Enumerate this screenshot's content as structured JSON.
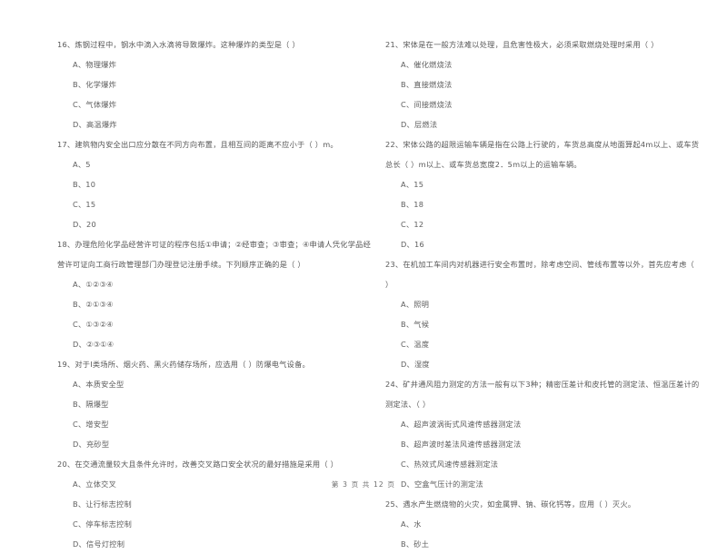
{
  "document": {
    "type": "exam-paper",
    "footer": "第 3 页  共 12 页"
  },
  "columns": [
    {
      "side": "left",
      "questions": [
        {
          "number": "16",
          "lines": [
            "16、炼钢过程中，钢水中滴入水滴将导致爆炸。这种爆炸的类型是（      ）"
          ],
          "options": [
            "A、物理爆炸",
            "B、化学爆炸",
            "C、气体爆炸",
            "D、高温爆炸"
          ]
        },
        {
          "number": "17",
          "lines": [
            "17、建筑物内安全出口应分散在不同方向布置，且相互间的距离不应小于（      ）m。"
          ],
          "options": [
            "A、5",
            "B、10",
            "C、15",
            "D、20"
          ]
        },
        {
          "number": "18",
          "lines": [
            "18、办理危险化学品经营许可证的程序包括①申请；②经审查；③审查；④申请人凭化学品经",
            "营许可证向工商行政管理部门办理登记注册手续。下列顺序正确的是（      ）"
          ],
          "options": [
            "A、①②③④",
            "B、②①③④",
            "C、①③②④",
            "D、②③①④"
          ]
        },
        {
          "number": "19",
          "lines": [
            "19、对于Ⅰ类场所、烟火药、黑火药储存场所，应选用（      ）防爆电气设备。"
          ],
          "options": [
            "A、本质安全型",
            "B、隔爆型",
            "C、增安型",
            "D、充砂型"
          ]
        },
        {
          "number": "20",
          "lines": [
            "20、在交通流量较大且条件允许时，改善交叉路口安全状况的最好措施是采用（      ）"
          ],
          "options": [
            "A、立体交叉",
            "B、让行标志控制",
            "C、停车标志控制",
            "D、信号灯控制"
          ]
        }
      ]
    },
    {
      "side": "right",
      "questions": [
        {
          "number": "21",
          "lines": [
            "21、宋体是在一般方法难以处理，且危害性极大，必须采取燃烧处理时采用（      ）"
          ],
          "options": [
            "A、催化燃烧法",
            "B、直接燃烧法",
            "C、间接燃烧法",
            "D、层燃法"
          ]
        },
        {
          "number": "22",
          "lines": [
            "22、宋体公路的超限运输车辆是指在公路上行驶的，车货总高度从地面算起4m以上、或车货",
            "总长（      ）m以上、或车货总宽度2．5m以上的运输车辆。"
          ],
          "options": [
            "A、15",
            "B、18",
            "C、12",
            "D、16"
          ]
        },
        {
          "number": "23",
          "lines": [
            "23、在机加工车间内对机器进行安全布置时，除考虑空间、管线布置等以外，首先应考虑（",
            "）"
          ],
          "options": [
            "A、照明",
            "B、气候",
            "C、温度",
            "D、湿度"
          ]
        },
        {
          "number": "24",
          "lines": [
            "24、矿井通风阻力测定的方法一般有以下3种；精密压差计和皮托管的测定法、恒温压差计的",
            "测定法、（      ）"
          ],
          "options": [
            "A、超声波涡街式风速传感器测定法",
            "B、超声波时差法风速传感器测定法",
            "C、热效式风速传感器测定法",
            "D、空盒气压计的测定法"
          ]
        },
        {
          "number": "25",
          "lines": [
            "25、遇水产生燃烧物的火灾，如金属钾、钠、碳化钙等，应用（      ）灭火。"
          ],
          "options": [
            "A、水",
            "B、砂土"
          ]
        }
      ]
    }
  ]
}
